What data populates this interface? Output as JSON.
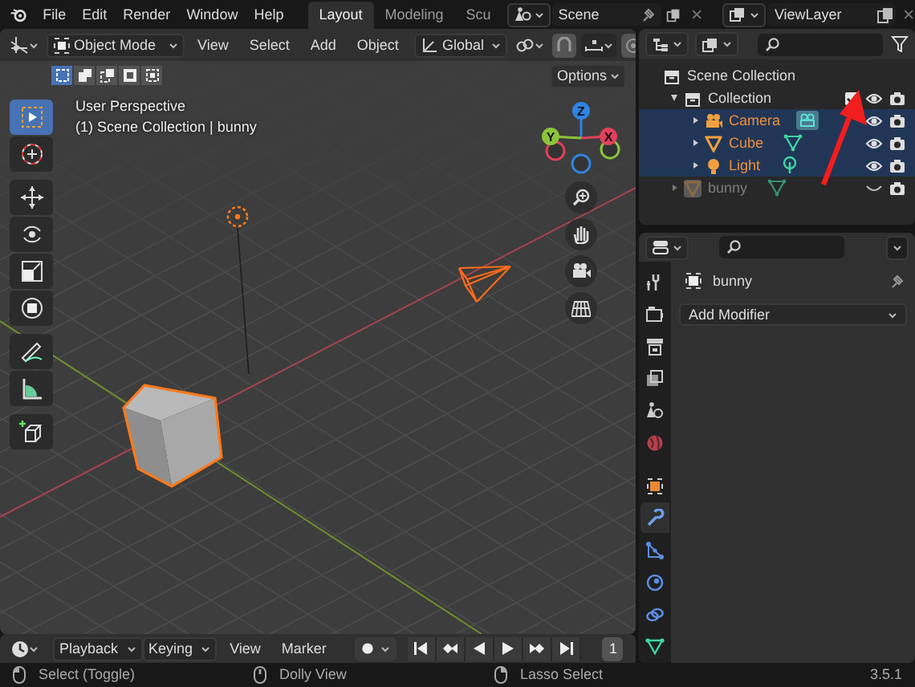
{
  "top_bar": {
    "menus": [
      "File",
      "Edit",
      "Render",
      "Window",
      "Help"
    ],
    "workspaces": [
      {
        "label": "Layout",
        "selected": true
      },
      {
        "label": "Modeling",
        "selected": false
      },
      {
        "label": "Scu",
        "selected": false
      }
    ],
    "scene": "Scene",
    "view_layer": "ViewLayer"
  },
  "viewport": {
    "mode": "Object Mode",
    "menus": [
      "View",
      "Select",
      "Add",
      "Object"
    ],
    "orientation": "Global",
    "select_modes": [
      {
        "selected": true
      },
      {
        "selected": false
      },
      {
        "selected": false
      },
      {
        "selected": false
      },
      {
        "selected": false
      }
    ],
    "options": "Options",
    "overlay_lines": [
      "User Perspective",
      "(1) Scene Collection | bunny"
    ],
    "tools": [
      {
        "selected": true
      },
      {
        "selected": false
      },
      {
        "selected": false
      },
      {
        "selected": false
      },
      {
        "selected": false
      },
      {
        "selected": false
      },
      {
        "selected": false
      },
      {
        "selected": false
      },
      {
        "selected": false
      }
    ],
    "gizmo_axes": [
      {
        "label": "Z",
        "color": "#2f84e3"
      },
      {
        "label": "Y",
        "color": "#8bc43a"
      },
      {
        "label": "X",
        "color": "#e0405a"
      }
    ]
  },
  "outliner": {
    "scene_collection": {
      "name": "Scene Collection",
      "children": [
        {
          "name": "Collection",
          "kind": "collection",
          "expanded": true,
          "checked": true,
          "visible": true,
          "selected": false,
          "active": false,
          "children": [
            {
              "name": "Camera",
              "kind": "camera",
              "expanded": false,
              "visible": true,
              "selected": true,
              "active": false
            },
            {
              "name": "Cube",
              "kind": "mesh",
              "expanded": false,
              "visible": true,
              "selected": true,
              "active": false
            },
            {
              "name": "Light",
              "kind": "light",
              "expanded": false,
              "visible": true,
              "selected": true,
              "active": false
            }
          ]
        },
        {
          "name": "bunny",
          "kind": "mesh",
          "expanded": false,
          "visible": false,
          "selected": false,
          "active": true
        }
      ]
    }
  },
  "properties": {
    "tabs": [
      {
        "selected": false
      },
      {
        "selected": false
      },
      {
        "selected": false
      },
      {
        "selected": false
      },
      {
        "selected": false
      },
      {
        "selected": false
      },
      {
        "selected": false
      },
      {
        "selected": true
      },
      {
        "selected": false
      },
      {
        "selected": false
      },
      {
        "selected": false
      },
      {
        "selected": false
      }
    ],
    "object_name": "bunny",
    "add_modifier": "Add Modifier"
  },
  "timeline": {
    "dropdowns": [
      "Playback",
      "Keying"
    ],
    "menus": [
      "View",
      "Marker"
    ],
    "frame": "1"
  },
  "status_bar": {
    "hints": [
      "Select (Toggle)",
      "Dolly View",
      "Lasso Select"
    ],
    "version": "3.5.1"
  },
  "annotations": [
    {
      "kind": "arrow"
    }
  ]
}
